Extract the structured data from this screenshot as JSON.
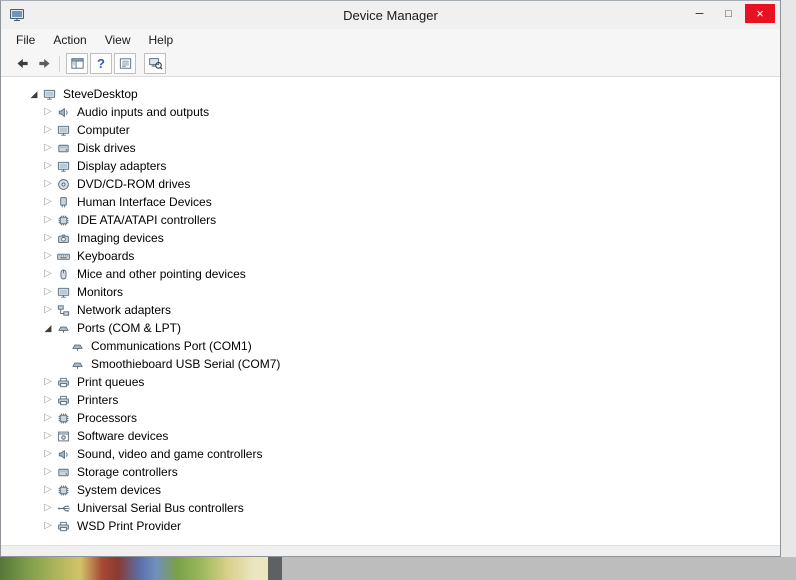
{
  "window": {
    "title": "Device Manager"
  },
  "titlebar": {
    "minimize_glyph": "–",
    "maximize_glyph": "□",
    "close_glyph": "×"
  },
  "menu": {
    "items": [
      "File",
      "Action",
      "View",
      "Help"
    ]
  },
  "toolbar": {
    "help_glyph": "?",
    "buttons": [
      "back",
      "forward",
      "show-hide-console-tree",
      "help",
      "properties",
      "scan-for-hardware-changes"
    ]
  },
  "tree": {
    "expanded_glyph": "◢",
    "collapsed_glyph": "▷",
    "items": [
      {
        "label": "SteveDesktop",
        "level": 0,
        "state": "expanded",
        "icon": "computer-icon"
      },
      {
        "label": "Audio inputs and outputs",
        "level": 1,
        "state": "collapsed",
        "icon": "audio-icon"
      },
      {
        "label": "Computer",
        "level": 1,
        "state": "collapsed",
        "icon": "computer-icon"
      },
      {
        "label": "Disk drives",
        "level": 1,
        "state": "collapsed",
        "icon": "disk-drive-icon"
      },
      {
        "label": "Display adapters",
        "level": 1,
        "state": "collapsed",
        "icon": "display-adapter-icon"
      },
      {
        "label": "DVD/CD-ROM drives",
        "level": 1,
        "state": "collapsed",
        "icon": "dvd-icon"
      },
      {
        "label": "Human Interface Devices",
        "level": 1,
        "state": "collapsed",
        "icon": "hid-icon"
      },
      {
        "label": "IDE ATA/ATAPI controllers",
        "level": 1,
        "state": "collapsed",
        "icon": "ide-controller-icon"
      },
      {
        "label": "Imaging devices",
        "level": 1,
        "state": "collapsed",
        "icon": "imaging-device-icon"
      },
      {
        "label": "Keyboards",
        "level": 1,
        "state": "collapsed",
        "icon": "keyboard-icon"
      },
      {
        "label": "Mice and other pointing devices",
        "level": 1,
        "state": "collapsed",
        "icon": "mouse-icon"
      },
      {
        "label": "Monitors",
        "level": 1,
        "state": "collapsed",
        "icon": "monitor-icon"
      },
      {
        "label": "Network adapters",
        "level": 1,
        "state": "collapsed",
        "icon": "network-adapter-icon"
      },
      {
        "label": "Ports (COM & LPT)",
        "level": 1,
        "state": "expanded",
        "icon": "port-icon"
      },
      {
        "label": "Communications Port (COM1)",
        "level": 2,
        "state": "leaf",
        "icon": "port-icon"
      },
      {
        "label": "Smoothieboard USB Serial (COM7)",
        "level": 2,
        "state": "leaf",
        "icon": "port-icon"
      },
      {
        "label": "Print queues",
        "level": 1,
        "state": "collapsed",
        "icon": "printer-icon"
      },
      {
        "label": "Printers",
        "level": 1,
        "state": "collapsed",
        "icon": "printer-icon"
      },
      {
        "label": "Processors",
        "level": 1,
        "state": "collapsed",
        "icon": "processor-icon"
      },
      {
        "label": "Software devices",
        "level": 1,
        "state": "collapsed",
        "icon": "software-device-icon"
      },
      {
        "label": "Sound, video and game controllers",
        "level": 1,
        "state": "collapsed",
        "icon": "sound-icon"
      },
      {
        "label": "Storage controllers",
        "level": 1,
        "state": "collapsed",
        "icon": "storage-controller-icon"
      },
      {
        "label": "System devices",
        "level": 1,
        "state": "collapsed",
        "icon": "system-device-icon"
      },
      {
        "label": "Universal Serial Bus controllers",
        "level": 1,
        "state": "collapsed",
        "icon": "usb-icon"
      },
      {
        "label": "WSD Print Provider",
        "level": 1,
        "state": "collapsed",
        "icon": "printer-icon"
      }
    ]
  },
  "colors": {
    "close_button_bg": "#e81123",
    "taskbar": "#bdbdbd"
  }
}
